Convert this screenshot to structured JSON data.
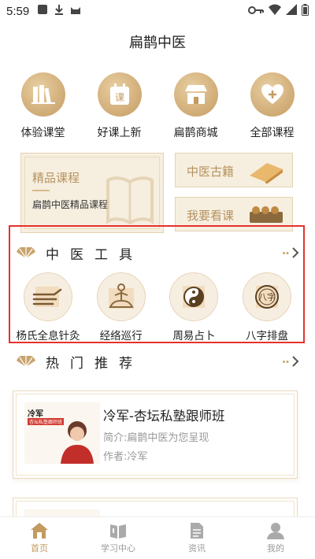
{
  "status_bar": {
    "time": "5:59"
  },
  "app_title": "扁鹊中医",
  "quick_links": [
    {
      "label": "体验课堂",
      "icon": "books-icon"
    },
    {
      "label": "好课上新",
      "icon": "calendar-course-icon"
    },
    {
      "label": "扁鹊商城",
      "icon": "store-icon"
    },
    {
      "label": "全部课程",
      "icon": "heart-plus-icon"
    }
  ],
  "featured": {
    "title": "精品课程",
    "subtitle": "扁鹊中医精品课程",
    "side_cards": [
      {
        "label": "中医古籍"
      },
      {
        "label": "我要看课"
      }
    ]
  },
  "tools_section": {
    "title": "中医工具",
    "items": [
      {
        "label": "杨氏全息针灸",
        "icon": "hand-acupuncture-icon"
      },
      {
        "label": "经络巡行",
        "icon": "meridian-figure-icon"
      },
      {
        "label": "周易占卜",
        "icon": "yin-yang-icon"
      },
      {
        "label": "八字排盘",
        "icon": "bazi-plate-icon"
      }
    ]
  },
  "hot_section": {
    "title": "热门推荐",
    "items": [
      {
        "thumb_name": "冷军",
        "thumb_tag": "杏坛私塾跟师班",
        "title": "冷军-杏坛私塾跟师班",
        "desc": "简介:扁鹊中医为您呈现",
        "author": "作者:冷军"
      }
    ]
  },
  "tab_bar": {
    "active_index": 0,
    "tabs": [
      {
        "label": "首页",
        "icon": "home-icon"
      },
      {
        "label": "学习中心",
        "icon": "book-icon"
      },
      {
        "label": "资讯",
        "icon": "document-icon"
      },
      {
        "label": "我的",
        "icon": "user-icon"
      }
    ]
  },
  "colors": {
    "accent": "#c39a5f",
    "highlight_border": "#e5322d",
    "card_bg": "#f6efe0"
  }
}
